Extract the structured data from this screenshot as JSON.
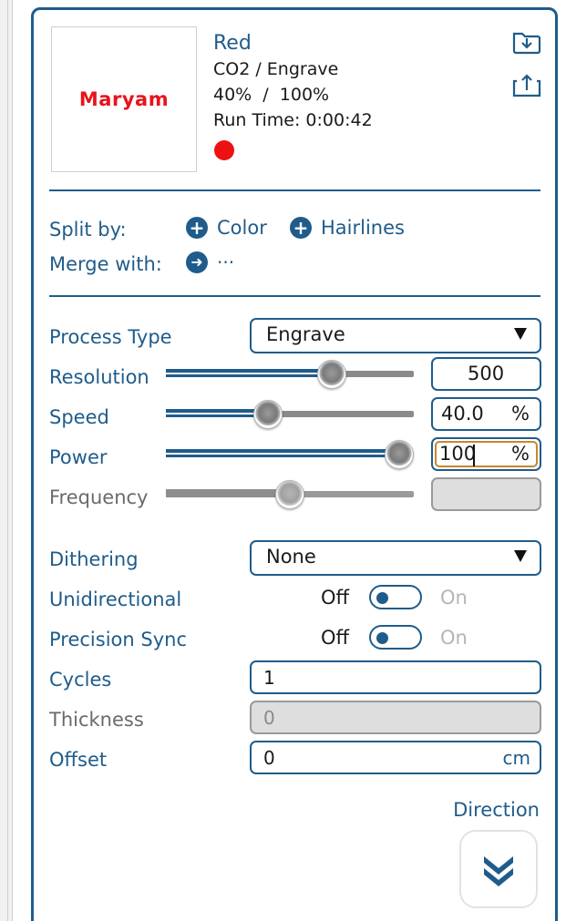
{
  "layer": {
    "thumbnail_text": "Maryam",
    "name": "Red",
    "process_line": "CO2 / Engrave",
    "power_line": "40%  /  100%",
    "run_time": "Run Time: 0:00:42",
    "color": "#ee1111"
  },
  "split": {
    "label": "Split by:",
    "color_label": "Color",
    "hairlines_label": "Hairlines"
  },
  "merge": {
    "label": "Merge with:",
    "value": "···"
  },
  "process_type": {
    "label": "Process Type",
    "value": "Engrave"
  },
  "resolution": {
    "label": "Resolution",
    "value": "500",
    "slider_fraction": 0.69
  },
  "speed": {
    "label": "Speed",
    "value": "40.0",
    "unit": "%",
    "slider_fraction": 0.4
  },
  "power": {
    "label": "Power",
    "value": "100",
    "unit": "%",
    "slider_fraction": 1.0
  },
  "frequency": {
    "label": "Frequency",
    "value": "",
    "slider_fraction": 0.5
  },
  "dithering": {
    "label": "Dithering",
    "value": "None"
  },
  "unidirectional": {
    "label": "Unidirectional",
    "off": "Off",
    "on": "On",
    "state": "Off"
  },
  "precision_sync": {
    "label": "Precision Sync",
    "off": "Off",
    "on": "On",
    "state": "Off"
  },
  "cycles": {
    "label": "Cycles",
    "value": "1"
  },
  "thickness": {
    "label": "Thickness",
    "value": "0"
  },
  "offset": {
    "label": "Offset",
    "value": "0",
    "unit": "cm"
  },
  "direction": {
    "label": "Direction"
  },
  "icons": [
    "folder-import-icon",
    "export-icon",
    "plus-circle-icon",
    "arrow-right-circle-icon",
    "chevron-double-down-icon"
  ],
  "colors": {
    "accent": "#1f5c8b",
    "layer_red": "#ee1111",
    "focus": "#c8862b"
  }
}
